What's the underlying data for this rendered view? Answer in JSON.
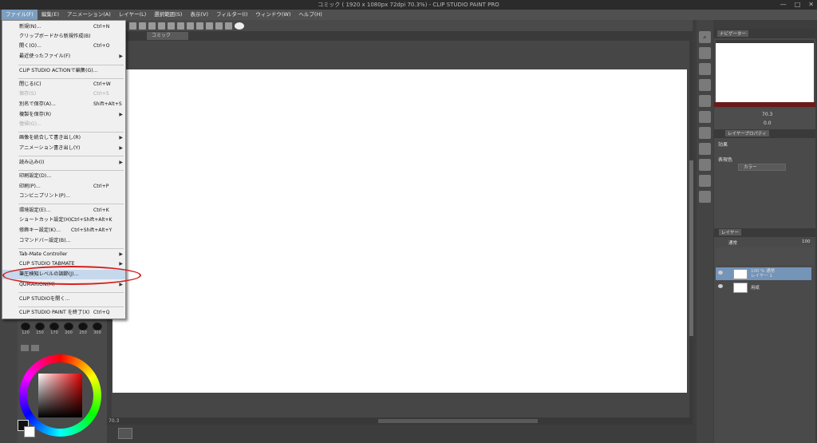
{
  "window": {
    "title": "コミック ( 1920 x 1080px 72dpi 70.3%)  - CLIP STUDIO PAINT PRO",
    "controls": [
      "—",
      "□",
      "✕"
    ]
  },
  "menubar": {
    "items": [
      "ファイル(F)",
      "編集(E)",
      "アニメーション(A)",
      "レイヤー(L)",
      "選択範囲(S)",
      "表示(V)",
      "フィルター(I)",
      "ウィンドウ(W)",
      "ヘルプ(H)"
    ],
    "active_index": 0
  },
  "document_tab": "コミック",
  "file_menu": {
    "items": [
      {
        "label": "新規(N)...",
        "shortcut": "Ctrl+N",
        "submenu": false,
        "disabled": false
      },
      {
        "label": "クリップボードから新規作成(B)",
        "shortcut": "",
        "submenu": false,
        "disabled": false
      },
      {
        "label": "開く(O)...",
        "shortcut": "Ctrl+O",
        "submenu": false,
        "disabled": false
      },
      {
        "label": "最近使ったファイル(F)",
        "shortcut": "",
        "submenu": true,
        "disabled": false
      },
      {
        "label": "CLIP STUDIO ACTIONで編集(G)...",
        "shortcut": "",
        "submenu": false,
        "disabled": false
      },
      {
        "label": "閉じる(C)",
        "shortcut": "Ctrl+W",
        "submenu": false,
        "disabled": false
      },
      {
        "label": "保存(S)",
        "shortcut": "Ctrl+S",
        "submenu": false,
        "disabled": true
      },
      {
        "label": "別名で保存(A)...",
        "shortcut": "Shift+Alt+S",
        "submenu": false,
        "disabled": false
      },
      {
        "label": "複製を保存(R)",
        "shortcut": "",
        "submenu": true,
        "disabled": false
      },
      {
        "label": "復帰(G)...",
        "shortcut": "",
        "submenu": false,
        "disabled": true
      },
      {
        "label": "画像を統合して書き出し(R)",
        "shortcut": "",
        "submenu": true,
        "disabled": false
      },
      {
        "label": "アニメーション書き出し(Y)",
        "shortcut": "",
        "submenu": true,
        "disabled": false
      },
      {
        "label": "読み込み(I)",
        "shortcut": "",
        "submenu": true,
        "disabled": false
      },
      {
        "label": "印刷設定(D)...",
        "shortcut": "",
        "submenu": false,
        "disabled": false
      },
      {
        "label": "印刷(P)...",
        "shortcut": "Ctrl+P",
        "submenu": false,
        "disabled": false
      },
      {
        "label": "コンビニプリント(P)...",
        "shortcut": "",
        "submenu": false,
        "disabled": false
      },
      {
        "label": "環境設定(E)...",
        "shortcut": "Ctrl+K",
        "submenu": false,
        "disabled": false
      },
      {
        "label": "ショートカット設定(H)...",
        "shortcut": "Ctrl+Shift+Alt+K",
        "submenu": false,
        "disabled": false
      },
      {
        "label": "修飾キー設定(K)...",
        "shortcut": "Ctrl+Shift+Alt+Y",
        "submenu": false,
        "disabled": false
      },
      {
        "label": "コマンドバー設定(B)...",
        "shortcut": "",
        "submenu": false,
        "disabled": false
      },
      {
        "label": "Tab-Mate Controller",
        "shortcut": "",
        "submenu": true,
        "disabled": false
      },
      {
        "label": "CLIP STUDIO TABMATE",
        "shortcut": "",
        "submenu": true,
        "disabled": false
      },
      {
        "label": "筆圧検知レベルの調節(J)...",
        "shortcut": "",
        "submenu": false,
        "disabled": false
      },
      {
        "label": "QUMARION(M)",
        "shortcut": "",
        "submenu": true,
        "disabled": false
      },
      {
        "label": "CLIP STUDIOを開く...",
        "shortcut": "",
        "submenu": false,
        "disabled": false
      },
      {
        "label": "CLIP STUDIO PAINT を終了(X)",
        "shortcut": "Ctrl+Q",
        "submenu": false,
        "disabled": false
      }
    ],
    "highlighted_index": 22
  },
  "brush_sizes": [
    "120",
    "150",
    "170",
    "200",
    "250",
    "300"
  ],
  "navigator": {
    "tab_label": "ナビゲーター",
    "zoom_value": "70.3",
    "rotate_value": "0.0"
  },
  "layer_property": {
    "tab_label": "レイヤープロパティ",
    "effect_label": "効果",
    "display_color_label": "表現色",
    "display_color_value": "カラー"
  },
  "layers": {
    "tab_label": "レイヤー",
    "blend_mode": "通常",
    "opacity": "100",
    "items": [
      {
        "line1": "100 % 通常",
        "line2": "レイヤー 1",
        "selected": true
      },
      {
        "line1": "用紙",
        "line2": "",
        "selected": false
      }
    ]
  },
  "status": {
    "zoom": "70.3"
  },
  "colors": {
    "menu_active": "#7b9ec2",
    "highlight": "#c6d8ec",
    "annotation": "#d61f1f",
    "layer_selected": "#7494b8"
  }
}
